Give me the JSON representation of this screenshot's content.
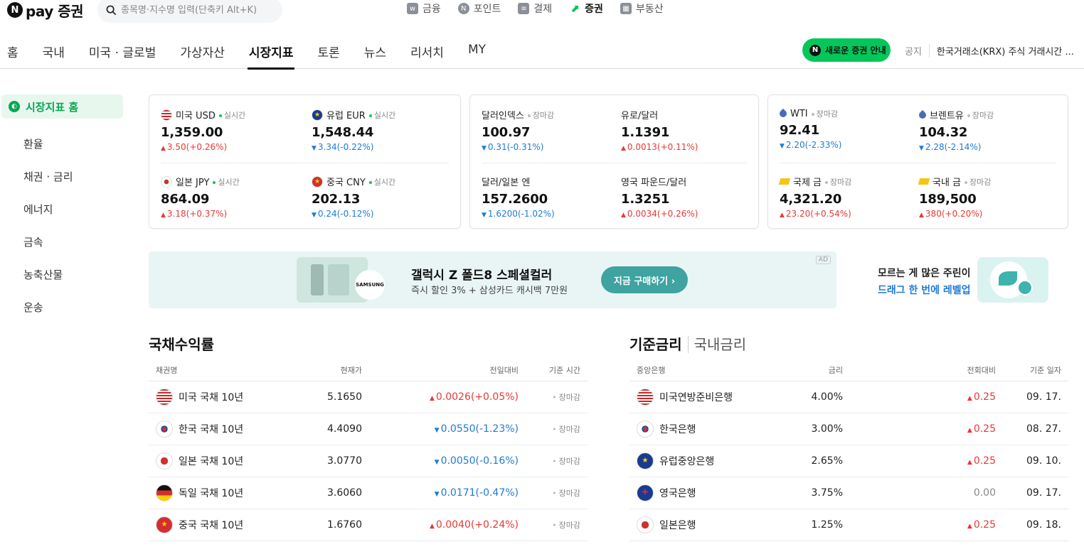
{
  "brand": {
    "logo_letter": "N",
    "name": "pay 증권"
  },
  "search": {
    "placeholder": "종목명·지수명 입력(단축키 Alt+K)"
  },
  "services": [
    {
      "label": "금융",
      "icon": "finance-icon"
    },
    {
      "label": "포인트",
      "icon": "point-icon"
    },
    {
      "label": "결제",
      "icon": "payment-icon"
    },
    {
      "label": "증권",
      "icon": "chart-up-icon",
      "active": true
    },
    {
      "label": "부동산",
      "icon": "building-icon"
    }
  ],
  "nav": {
    "tabs": [
      "홈",
      "국내",
      "미국 · 글로벌",
      "가상자산",
      "시장지표",
      "토론",
      "뉴스",
      "리서치",
      "MY"
    ],
    "active": "시장지표",
    "new_button": "새로운 증권 안내",
    "notice_label": "공지",
    "notice_text": "한국거래소(KRX) 주식 거래시간 ..."
  },
  "sidebar": [
    {
      "label": "시장지표 홈",
      "active": true
    },
    {
      "label": "환율"
    },
    {
      "label": "채권 · 금리"
    },
    {
      "label": "에너지"
    },
    {
      "label": "금속"
    },
    {
      "label": "농축산물"
    },
    {
      "label": "운송"
    }
  ],
  "cards": [
    {
      "items": [
        {
          "name": "미국 USD",
          "status": "실시간",
          "value": "1,359.00",
          "change": "3.50(+0.26%)",
          "dir": "up",
          "flag": "us"
        },
        {
          "name": "유럽 EUR",
          "status": "실시간",
          "value": "1,548.44",
          "change": "3.34(-0.22%)",
          "dir": "dn",
          "flag": "eu"
        },
        {
          "name": "일본 JPY",
          "status": "실시간",
          "value": "864.09",
          "change": "3.18(+0.37%)",
          "dir": "up",
          "flag": "jp"
        },
        {
          "name": "중국 CNY",
          "status": "실시간",
          "value": "202.13",
          "change": "0.24(-0.12%)",
          "dir": "dn",
          "flag": "cn"
        }
      ]
    },
    {
      "items": [
        {
          "name": "달러인덱스",
          "status": "장마감",
          "value": "100.97",
          "change": "0.31(-0.31%)",
          "dir": "dn"
        },
        {
          "name": "유로/달러",
          "status": "",
          "value": "1.1391",
          "change": "0.0013(+0.11%)",
          "dir": "up"
        },
        {
          "name": "달러/일본 엔",
          "status": "",
          "value": "157.2600",
          "change": "1.6200(-1.02%)",
          "dir": "dn"
        },
        {
          "name": "영국 파운드/달러",
          "status": "",
          "value": "1.3251",
          "change": "0.0034(+0.26%)",
          "dir": "up"
        }
      ]
    },
    {
      "items": [
        {
          "name": "WTI",
          "status": "장마감",
          "value": "92.41",
          "change": "2.20(-2.33%)",
          "dir": "dn",
          "icon": "oil-drop-icon"
        },
        {
          "name": "브렌트유",
          "status": "장마감",
          "value": "104.32",
          "change": "2.28(-2.14%)",
          "dir": "dn",
          "icon": "oil-drop-icon"
        },
        {
          "name": "국제 금",
          "status": "장마감",
          "value": "4,321.20",
          "change": "23.20(+0.54%)",
          "dir": "up",
          "icon": "gold-bar-icon"
        },
        {
          "name": "국내 금",
          "status": "장마감",
          "value": "189,500",
          "change": "380(+0.20%)",
          "dir": "up",
          "icon": "gold-bar-icon"
        }
      ]
    }
  ],
  "ad": {
    "brand": "SAMSUNG",
    "title": "갤럭시 Z 폴드8 스페셜컬러",
    "subtitle": "즉시 할인 3% + 삼성카드 캐시백 7만원",
    "button": "지금 구매하기 ›",
    "tag": "AD"
  },
  "promo": {
    "line1": "모르는 게 많은 주린이",
    "line2": "드래그 한 번에 레벨업"
  },
  "bonds": {
    "title": "국채수익률",
    "headers": [
      "채권명",
      "현재가",
      "전일대비",
      "기준 시간"
    ],
    "rows": [
      {
        "name": "미국 국채 10년",
        "price": "5.1650",
        "change": "0.0026(+0.05%)",
        "dir": "up",
        "time": "장마감",
        "flag": "us"
      },
      {
        "name": "한국 국채 10년",
        "price": "4.4090",
        "change": "0.0550(-1.23%)",
        "dir": "dn",
        "time": "장마감",
        "flag": "kr"
      },
      {
        "name": "일본 국채 10년",
        "price": "3.0770",
        "change": "0.0050(-0.16%)",
        "dir": "dn",
        "time": "장마감",
        "flag": "jp"
      },
      {
        "name": "독일 국채 10년",
        "price": "3.6060",
        "change": "0.0171(-0.47%)",
        "dir": "dn",
        "time": "장마감",
        "flag": "de"
      },
      {
        "name": "중국 국채 10년",
        "price": "1.6760",
        "change": "0.0040(+0.24%)",
        "dir": "up",
        "time": "장마감",
        "flag": "cn"
      }
    ]
  },
  "rates": {
    "title": "기준금리",
    "alt_tab": "국내금리",
    "headers": [
      "중앙은행",
      "금리",
      "전회대비",
      "기준 일자"
    ],
    "rows": [
      {
        "name": "미국연방준비은행",
        "rate": "4.00%",
        "change": "0.25",
        "dir": "up",
        "date": "09. 17.",
        "flag": "us"
      },
      {
        "name": "한국은행",
        "rate": "3.00%",
        "change": "0.25",
        "dir": "up",
        "date": "08. 27.",
        "flag": "kr"
      },
      {
        "name": "유럽중앙은행",
        "rate": "2.65%",
        "change": "0.25",
        "dir": "up",
        "date": "09. 10.",
        "flag": "eu"
      },
      {
        "name": "영국은행",
        "rate": "3.75%",
        "change": "0.00",
        "dir": "flat",
        "date": "09. 17.",
        "flag": "gb"
      },
      {
        "name": "일본은행",
        "rate": "1.25%",
        "change": "0.25",
        "dir": "up",
        "date": "09. 18.",
        "flag": "jp"
      }
    ]
  },
  "colors": {
    "up": "#e53935",
    "down": "#1e7bd6",
    "accent": "#03c75a"
  }
}
